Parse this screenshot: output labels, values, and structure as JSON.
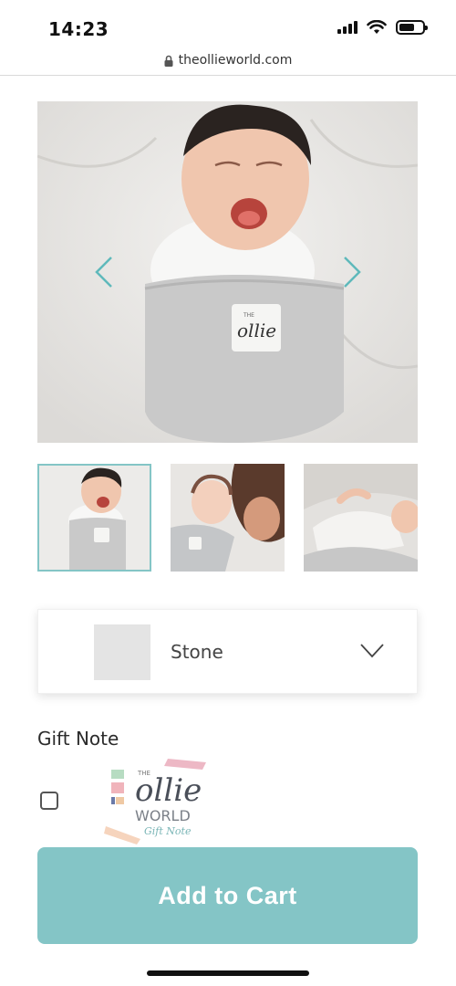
{
  "status_bar": {
    "time": "14:23",
    "icons": [
      "signal-icon",
      "wifi-icon",
      "battery-icon"
    ]
  },
  "browser": {
    "url": "theollieworld.com",
    "lock_icon": "lock-icon"
  },
  "gallery": {
    "hero_label": "ollie",
    "hero_brand_small": "THE",
    "prev_icon": "chevron-left-icon",
    "next_icon": "chevron-right-icon",
    "thumbnails": [
      {
        "name": "thumb-yawning-baby",
        "active": true
      },
      {
        "name": "thumb-baby-with-mother",
        "active": false
      },
      {
        "name": "thumb-baby-sleeping",
        "active": false
      }
    ]
  },
  "color_selector": {
    "selected": "Stone",
    "swatch_color": "#e4e4e4",
    "chevron_icon": "chevron-down-icon"
  },
  "gift_note": {
    "title": "Gift Note",
    "checked": false,
    "logo_the": "THE",
    "logo_ollie": "ollie",
    "logo_world": "WORLD",
    "logo_gift": "Gift Note"
  },
  "cart": {
    "button_label": "Add to Cart",
    "accent_color": "#84c5c6"
  }
}
